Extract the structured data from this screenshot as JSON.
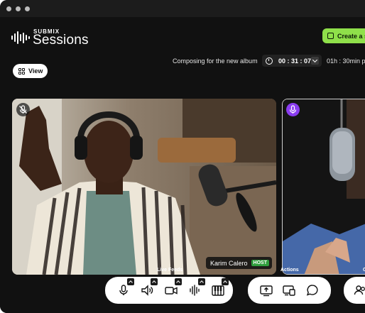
{
  "brand": {
    "top": "SUBMIX",
    "name": "Sessions"
  },
  "header": {
    "create_label": "Create a s",
    "session_title": "Composing for the new album",
    "timer": "00 : 31 : 07",
    "remaining": "01h : 30min p"
  },
  "toolbar": {
    "view_label": "View"
  },
  "feeds": [
    {
      "name": "Karim Calero",
      "badge": "HOST",
      "mic": "muted"
    },
    {
      "mic": "active"
    }
  ],
  "controls": {
    "group_labels": [
      "Live Feeds",
      "Actions",
      "C"
    ]
  },
  "colors": {
    "accent_green": "#8fe04a",
    "mic_purple": "#8a3cf0",
    "host_green": "#2f9e3d"
  }
}
